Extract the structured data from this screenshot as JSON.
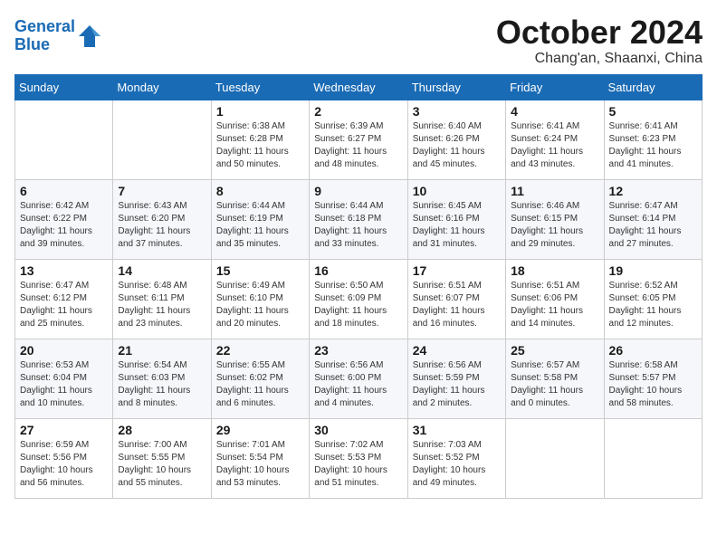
{
  "logo": {
    "line1": "General",
    "line2": "Blue"
  },
  "title": "October 2024",
  "location": "Chang'an, Shaanxi, China",
  "weekdays": [
    "Sunday",
    "Monday",
    "Tuesday",
    "Wednesday",
    "Thursday",
    "Friday",
    "Saturday"
  ],
  "weeks": [
    [
      {
        "day": "",
        "sunrise": "",
        "sunset": "",
        "daylight": ""
      },
      {
        "day": "",
        "sunrise": "",
        "sunset": "",
        "daylight": ""
      },
      {
        "day": "1",
        "sunrise": "Sunrise: 6:38 AM",
        "sunset": "Sunset: 6:28 PM",
        "daylight": "Daylight: 11 hours and 50 minutes."
      },
      {
        "day": "2",
        "sunrise": "Sunrise: 6:39 AM",
        "sunset": "Sunset: 6:27 PM",
        "daylight": "Daylight: 11 hours and 48 minutes."
      },
      {
        "day": "3",
        "sunrise": "Sunrise: 6:40 AM",
        "sunset": "Sunset: 6:26 PM",
        "daylight": "Daylight: 11 hours and 45 minutes."
      },
      {
        "day": "4",
        "sunrise": "Sunrise: 6:41 AM",
        "sunset": "Sunset: 6:24 PM",
        "daylight": "Daylight: 11 hours and 43 minutes."
      },
      {
        "day": "5",
        "sunrise": "Sunrise: 6:41 AM",
        "sunset": "Sunset: 6:23 PM",
        "daylight": "Daylight: 11 hours and 41 minutes."
      }
    ],
    [
      {
        "day": "6",
        "sunrise": "Sunrise: 6:42 AM",
        "sunset": "Sunset: 6:22 PM",
        "daylight": "Daylight: 11 hours and 39 minutes."
      },
      {
        "day": "7",
        "sunrise": "Sunrise: 6:43 AM",
        "sunset": "Sunset: 6:20 PM",
        "daylight": "Daylight: 11 hours and 37 minutes."
      },
      {
        "day": "8",
        "sunrise": "Sunrise: 6:44 AM",
        "sunset": "Sunset: 6:19 PM",
        "daylight": "Daylight: 11 hours and 35 minutes."
      },
      {
        "day": "9",
        "sunrise": "Sunrise: 6:44 AM",
        "sunset": "Sunset: 6:18 PM",
        "daylight": "Daylight: 11 hours and 33 minutes."
      },
      {
        "day": "10",
        "sunrise": "Sunrise: 6:45 AM",
        "sunset": "Sunset: 6:16 PM",
        "daylight": "Daylight: 11 hours and 31 minutes."
      },
      {
        "day": "11",
        "sunrise": "Sunrise: 6:46 AM",
        "sunset": "Sunset: 6:15 PM",
        "daylight": "Daylight: 11 hours and 29 minutes."
      },
      {
        "day": "12",
        "sunrise": "Sunrise: 6:47 AM",
        "sunset": "Sunset: 6:14 PM",
        "daylight": "Daylight: 11 hours and 27 minutes."
      }
    ],
    [
      {
        "day": "13",
        "sunrise": "Sunrise: 6:47 AM",
        "sunset": "Sunset: 6:12 PM",
        "daylight": "Daylight: 11 hours and 25 minutes."
      },
      {
        "day": "14",
        "sunrise": "Sunrise: 6:48 AM",
        "sunset": "Sunset: 6:11 PM",
        "daylight": "Daylight: 11 hours and 23 minutes."
      },
      {
        "day": "15",
        "sunrise": "Sunrise: 6:49 AM",
        "sunset": "Sunset: 6:10 PM",
        "daylight": "Daylight: 11 hours and 20 minutes."
      },
      {
        "day": "16",
        "sunrise": "Sunrise: 6:50 AM",
        "sunset": "Sunset: 6:09 PM",
        "daylight": "Daylight: 11 hours and 18 minutes."
      },
      {
        "day": "17",
        "sunrise": "Sunrise: 6:51 AM",
        "sunset": "Sunset: 6:07 PM",
        "daylight": "Daylight: 11 hours and 16 minutes."
      },
      {
        "day": "18",
        "sunrise": "Sunrise: 6:51 AM",
        "sunset": "Sunset: 6:06 PM",
        "daylight": "Daylight: 11 hours and 14 minutes."
      },
      {
        "day": "19",
        "sunrise": "Sunrise: 6:52 AM",
        "sunset": "Sunset: 6:05 PM",
        "daylight": "Daylight: 11 hours and 12 minutes."
      }
    ],
    [
      {
        "day": "20",
        "sunrise": "Sunrise: 6:53 AM",
        "sunset": "Sunset: 6:04 PM",
        "daylight": "Daylight: 11 hours and 10 minutes."
      },
      {
        "day": "21",
        "sunrise": "Sunrise: 6:54 AM",
        "sunset": "Sunset: 6:03 PM",
        "daylight": "Daylight: 11 hours and 8 minutes."
      },
      {
        "day": "22",
        "sunrise": "Sunrise: 6:55 AM",
        "sunset": "Sunset: 6:02 PM",
        "daylight": "Daylight: 11 hours and 6 minutes."
      },
      {
        "day": "23",
        "sunrise": "Sunrise: 6:56 AM",
        "sunset": "Sunset: 6:00 PM",
        "daylight": "Daylight: 11 hours and 4 minutes."
      },
      {
        "day": "24",
        "sunrise": "Sunrise: 6:56 AM",
        "sunset": "Sunset: 5:59 PM",
        "daylight": "Daylight: 11 hours and 2 minutes."
      },
      {
        "day": "25",
        "sunrise": "Sunrise: 6:57 AM",
        "sunset": "Sunset: 5:58 PM",
        "daylight": "Daylight: 11 hours and 0 minutes."
      },
      {
        "day": "26",
        "sunrise": "Sunrise: 6:58 AM",
        "sunset": "Sunset: 5:57 PM",
        "daylight": "Daylight: 10 hours and 58 minutes."
      }
    ],
    [
      {
        "day": "27",
        "sunrise": "Sunrise: 6:59 AM",
        "sunset": "Sunset: 5:56 PM",
        "daylight": "Daylight: 10 hours and 56 minutes."
      },
      {
        "day": "28",
        "sunrise": "Sunrise: 7:00 AM",
        "sunset": "Sunset: 5:55 PM",
        "daylight": "Daylight: 10 hours and 55 minutes."
      },
      {
        "day": "29",
        "sunrise": "Sunrise: 7:01 AM",
        "sunset": "Sunset: 5:54 PM",
        "daylight": "Daylight: 10 hours and 53 minutes."
      },
      {
        "day": "30",
        "sunrise": "Sunrise: 7:02 AM",
        "sunset": "Sunset: 5:53 PM",
        "daylight": "Daylight: 10 hours and 51 minutes."
      },
      {
        "day": "31",
        "sunrise": "Sunrise: 7:03 AM",
        "sunset": "Sunset: 5:52 PM",
        "daylight": "Daylight: 10 hours and 49 minutes."
      },
      {
        "day": "",
        "sunrise": "",
        "sunset": "",
        "daylight": ""
      },
      {
        "day": "",
        "sunrise": "",
        "sunset": "",
        "daylight": ""
      }
    ]
  ]
}
